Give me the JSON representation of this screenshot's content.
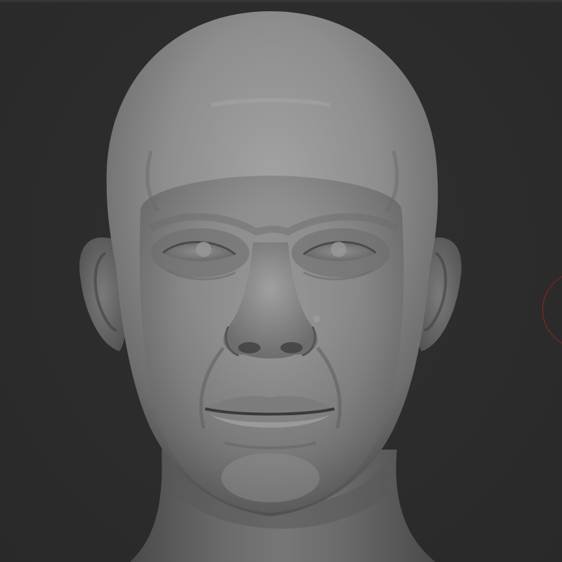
{
  "viewport": {
    "background_color": "#2c2c2c",
    "model": "sculpted-head",
    "material_color": "#8c8c8c"
  },
  "brush": {
    "cursor_color": "#9a2020",
    "icon": "brush-cursor-circle"
  }
}
